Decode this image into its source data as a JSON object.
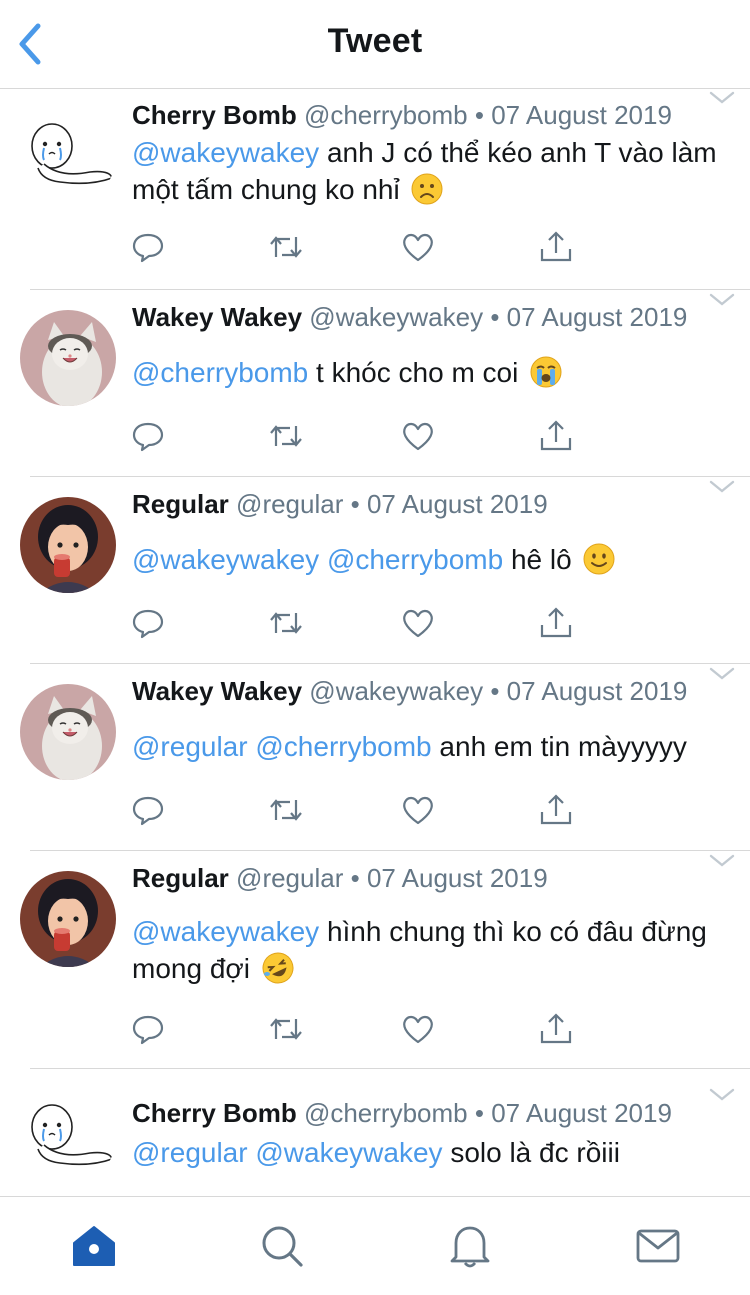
{
  "header": {
    "title": "Tweet",
    "back_icon": "chevron-left-icon",
    "accent": "#4a99e9"
  },
  "tweets": [
    {
      "name": "Cherry Bomb",
      "handle": "@cherrybomb",
      "separator": "•",
      "date": "07 August 2019",
      "avatar": "seal-drawing-avatar",
      "mentions": [
        "@wakeywakey"
      ],
      "text": "anh J có thể kéo anh T vào làm một tấm chung ko nhỉ",
      "emoji": "frowning-face"
    },
    {
      "name": "Wakey Wakey",
      "handle": "@wakeywakey",
      "separator": "•",
      "date": "07 August 2019",
      "avatar": "cat-photo-avatar",
      "mentions": [
        "@cherrybomb"
      ],
      "text": "t khóc cho m coi",
      "emoji": "loudly-crying-face"
    },
    {
      "name": "Regular",
      "handle": "@regular",
      "separator": "•",
      "date": "07 August 2019",
      "avatar": "cartoon-girl-avatar",
      "mentions": [
        "@wakeywakey",
        "@cherrybomb"
      ],
      "text": "hê lô",
      "emoji": "slightly-smiling-face"
    },
    {
      "name": "Wakey Wakey",
      "handle": "@wakeywakey",
      "separator": "•",
      "date": "07 August 2019",
      "avatar": "cat-photo-avatar",
      "mentions": [
        "@regular",
        "@cherrybomb"
      ],
      "text": "anh em tin màyyyyy",
      "emoji": ""
    },
    {
      "name": "Regular",
      "handle": "@regular",
      "separator": "•",
      "date": "07 August 2019",
      "avatar": "cartoon-girl-avatar",
      "mentions": [
        "@wakeywakey"
      ],
      "text": "hình chung thì ko có đâu đừng mong đợi",
      "emoji": "rolling-on-floor-laughing-face"
    },
    {
      "name": "Cherry Bomb",
      "handle": "@cherrybomb",
      "separator": "•",
      "date": "07 August 2019",
      "avatar": "seal-drawing-avatar",
      "mentions": [
        "@regular",
        "@wakeywakey"
      ],
      "text": "solo là đc rồiii",
      "emoji": ""
    }
  ],
  "action_icons": [
    "reply-icon",
    "retweet-icon",
    "like-icon",
    "share-icon"
  ],
  "tabbar": [
    {
      "icon": "home-icon",
      "active": true
    },
    {
      "icon": "search-icon",
      "active": false
    },
    {
      "icon": "notifications-bell-icon",
      "active": false
    },
    {
      "icon": "messages-envelope-icon",
      "active": false
    }
  ],
  "colors": {
    "mention": "#4a99e9",
    "meta": "#657786",
    "active_tab": "#1d5eb3",
    "icon": "#657786"
  }
}
